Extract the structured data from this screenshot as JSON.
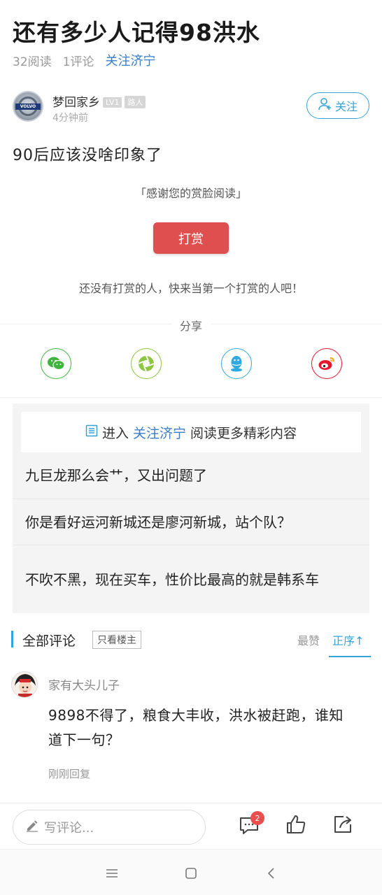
{
  "article": {
    "title": "还有多少人记得98洪水",
    "reads": "32阅读",
    "comments": "1评论",
    "topic": "关注济宁",
    "content": "90后应该没啥印象了"
  },
  "author": {
    "name": "梦回家乡",
    "level_badge": "LV1",
    "rank_badge": "路人",
    "time": "4分钟前",
    "avatar_icon": "volvo-logo-avatar",
    "logo_text": "VOLVO",
    "follow_label": "关注"
  },
  "reward": {
    "thanks": "「感谢您的赏脸阅读」",
    "button_label": "打赏",
    "empty_text": "还没有打赏的人，快来当第一个打赏的人吧！",
    "button_color": "#e04f4f"
  },
  "share": {
    "label": "分享",
    "targets": [
      {
        "name": "wechat-icon",
        "color": "#3db53d"
      },
      {
        "name": "moments-icon",
        "color": "#8dc63f"
      },
      {
        "name": "qq-icon",
        "color": "#2fa9e0"
      },
      {
        "name": "weibo-icon",
        "color": "#e6162d"
      }
    ]
  },
  "recommend": {
    "enter": "进入",
    "topic": "关注济宁",
    "more": "阅读更多精彩内容",
    "items": [
      "九巨龙那么会艹，又出问题了",
      "你是看好运河新城还是廖河新城，站个队？",
      "不吹不黑，现在买车，性价比最高的就是韩系车"
    ]
  },
  "comments_section": {
    "title": "全部评论",
    "filter": "只看楼主",
    "sort_hot": "最赞",
    "sort_order": "正序↑",
    "accent": "#34a3d8"
  },
  "comment": {
    "user": "家有大头儿子",
    "text": "9898不得了，粮食大丰收，洪水被赶跑，谁知道下一句？",
    "time": "刚刚回复"
  },
  "bottom_bar": {
    "placeholder": "写评论...",
    "comment_count": "2"
  }
}
